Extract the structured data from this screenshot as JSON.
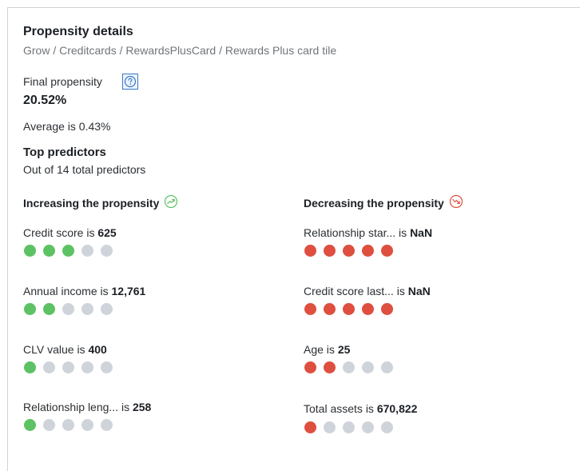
{
  "panel": {
    "title": "Propensity details",
    "breadcrumb": "Grow / Creditcards / RewardsPlusCard / Rewards Plus card tile",
    "final_propensity_label": "Final propensity",
    "final_propensity_value": "20.52%",
    "average_text": "Average is  0.43%",
    "top_predictors_title": "Top predictors",
    "top_predictors_subtitle": "Out of 14 total predictors"
  },
  "increasing": {
    "header": "Increasing the propensity",
    "icon": "trend-up-icon",
    "color": "#5cc264",
    "predictors": [
      {
        "name": "Credit score is ",
        "value": "625",
        "filled": 3,
        "total": 5
      },
      {
        "name": "Annual income is ",
        "value": "12,761",
        "filled": 2,
        "total": 5
      },
      {
        "name": "CLV value is ",
        "value": "400",
        "filled": 1,
        "total": 5
      },
      {
        "name": "Relationship leng... is ",
        "value": "258",
        "filled": 1,
        "total": 5
      }
    ]
  },
  "decreasing": {
    "header": "Decreasing the propensity",
    "icon": "trend-down-icon",
    "color": "#de4f3f",
    "predictors": [
      {
        "name": "Relationship star... is ",
        "value": "NaN",
        "filled": 5,
        "total": 5
      },
      {
        "name": "Credit score last... is ",
        "value": "NaN",
        "filled": 5,
        "total": 5
      },
      {
        "name": "Age is ",
        "value": "25",
        "filled": 2,
        "total": 5
      },
      {
        "name": "Total assets is ",
        "value": "670,822",
        "filled": 1,
        "total": 5
      }
    ]
  },
  "colors": {
    "inactive_dot": "#cfd4da",
    "help_icon_border": "#3a78c9"
  }
}
